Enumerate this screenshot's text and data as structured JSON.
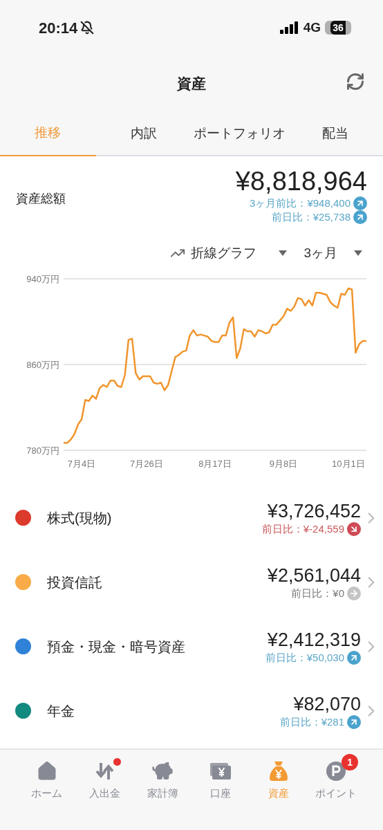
{
  "status_bar": {
    "time": "20:14",
    "network": "4G",
    "battery": "36"
  },
  "header": {
    "title": "資産"
  },
  "tabs": [
    {
      "label": "推移",
      "selected": true
    },
    {
      "label": "内訳",
      "selected": false
    },
    {
      "label": "ポートフォリオ",
      "selected": false
    },
    {
      "label": "配当",
      "selected": false
    }
  ],
  "total": {
    "label": "資産総額",
    "amount": "¥8,818,964",
    "changes": [
      {
        "text": "3ヶ月前比：¥948,400",
        "kind": "up"
      },
      {
        "text": "前日比：¥25,738",
        "kind": "up"
      }
    ]
  },
  "chart_controls": {
    "chart_type": "折線グラフ",
    "period": "3ヶ月"
  },
  "chart": {
    "chart_data": {
      "type": "line",
      "categories": [
        null,
        null,
        null,
        null,
        null,
        "7月4日",
        null,
        null,
        null,
        null,
        null,
        null,
        null,
        null,
        null,
        null,
        null,
        null,
        null,
        null,
        null,
        null,
        null,
        "7月26日",
        null,
        null,
        null,
        null,
        null,
        null,
        null,
        null,
        null,
        null,
        null,
        null,
        null,
        null,
        null,
        null,
        null,
        null,
        "8月17日",
        null,
        null,
        null,
        null,
        null,
        null,
        null,
        null,
        null,
        null,
        null,
        null,
        null,
        null,
        null,
        null,
        null,
        null,
        "9月8日",
        null,
        null,
        null,
        null,
        null,
        null,
        null,
        null,
        null,
        null,
        null,
        null,
        null,
        null,
        null,
        null,
        null,
        "10月1日",
        null,
        null,
        null,
        null,
        null
      ],
      "series": [
        {
          "color": "#f0952d",
          "values": [
            787,
            787,
            790,
            795,
            804,
            809,
            827,
            826,
            831,
            828,
            838,
            841,
            839,
            845,
            845,
            840,
            839,
            850,
            883,
            884,
            852,
            846,
            849,
            849,
            849,
            843,
            842,
            843,
            836,
            841,
            854,
            867,
            869,
            872,
            873,
            887,
            892,
            887,
            888,
            887,
            886,
            882,
            881,
            881,
            887,
            887,
            899,
            904,
            866,
            875,
            893,
            891,
            891,
            886,
            892,
            891,
            889,
            890,
            897,
            897,
            901,
            905,
            912,
            910,
            914,
            922,
            921,
            915,
            920,
            915,
            927,
            927,
            926,
            925,
            918,
            915,
            913,
            926,
            925,
            931,
            930,
            871,
            879,
            882,
            882
          ]
        }
      ],
      "ylim": [
        780,
        940
      ],
      "yticks": [
        {
          "value": 940,
          "label": "940万円"
        },
        {
          "value": 860,
          "label": "860万円"
        },
        {
          "value": 780,
          "label": "780万円"
        }
      ]
    }
  },
  "assets": [
    {
      "name": "株式(現物)",
      "color": "#dc3a2c",
      "amount": "¥3,726,452",
      "change": "前日比：¥-24,559",
      "kind": "down"
    },
    {
      "name": "投資信託",
      "color": "#f9ab4a",
      "amount": "¥2,561,044",
      "change": "前日比：¥0",
      "kind": "flat"
    },
    {
      "name": "預金・現金・暗号資産",
      "color": "#2f82d8",
      "amount": "¥2,412,319",
      "change": "前日比：¥50,030",
      "kind": "up"
    },
    {
      "name": "年金",
      "color": "#128a80",
      "amount": "¥82,070",
      "change": "前日比：¥281",
      "kind": "up"
    }
  ],
  "bottom_nav": [
    {
      "kind": "home",
      "label": "ホーム",
      "selected": false
    },
    {
      "kind": "transfer",
      "label": "入出金",
      "selected": false,
      "dot": true
    },
    {
      "kind": "budget",
      "label": "家計簿",
      "selected": false
    },
    {
      "kind": "account",
      "label": "口座",
      "selected": false
    },
    {
      "kind": "assets",
      "label": "資産",
      "selected": true
    },
    {
      "kind": "points",
      "label": "ポイント",
      "selected": false,
      "badge": "1"
    }
  ]
}
